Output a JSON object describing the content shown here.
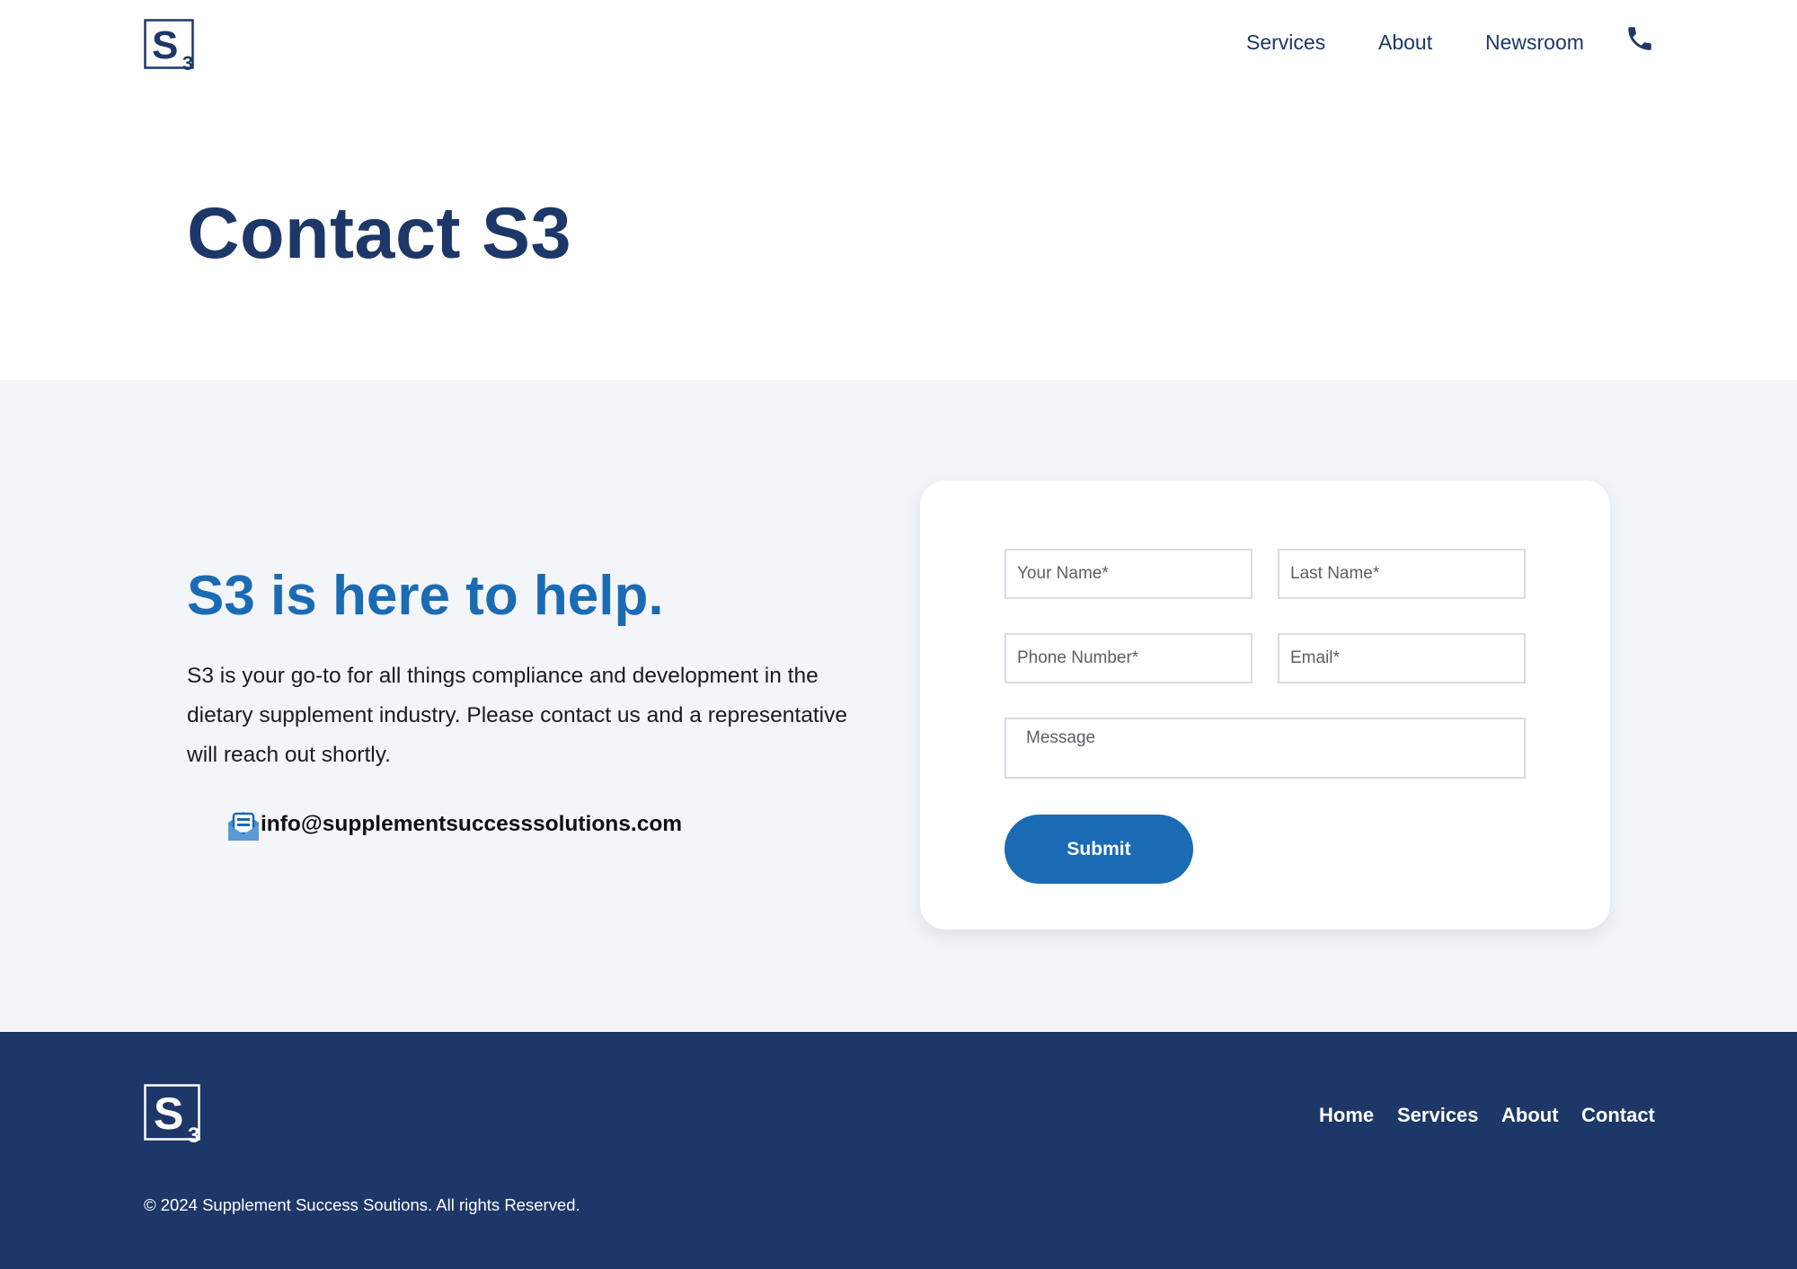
{
  "brand": {
    "logo_letter": "S",
    "logo_subscript": "3",
    "primary_color": "#1d3768",
    "accent_color": "#1b6bb4",
    "section_background": "#f3f5f8"
  },
  "header": {
    "nav": [
      {
        "label": "Services"
      },
      {
        "label": "About"
      },
      {
        "label": "Newsroom"
      }
    ],
    "phone_icon": "phone-icon"
  },
  "page": {
    "title": "Contact S3"
  },
  "contact": {
    "heading": "S3 is here to help.",
    "text": "S3 is your go-to for all things compliance and development in the dietary supplement industry. Please contact us and a representative will reach out shortly.",
    "email_icon": "mail-icon",
    "email": "info@supplementsuccesssolutions.com"
  },
  "form": {
    "first_name_placeholder": "Your Name*",
    "last_name_placeholder": "Last Name*",
    "phone_placeholder": "Phone Number*",
    "email_placeholder": "Email*",
    "message_placeholder": "Message",
    "submit_label": "Submit"
  },
  "footer": {
    "links": [
      {
        "label": "Home"
      },
      {
        "label": "Services"
      },
      {
        "label": "About"
      },
      {
        "label": "Contact"
      }
    ],
    "copyright": "© 2024 Supplement Success Soutions. All rights Reserved."
  }
}
